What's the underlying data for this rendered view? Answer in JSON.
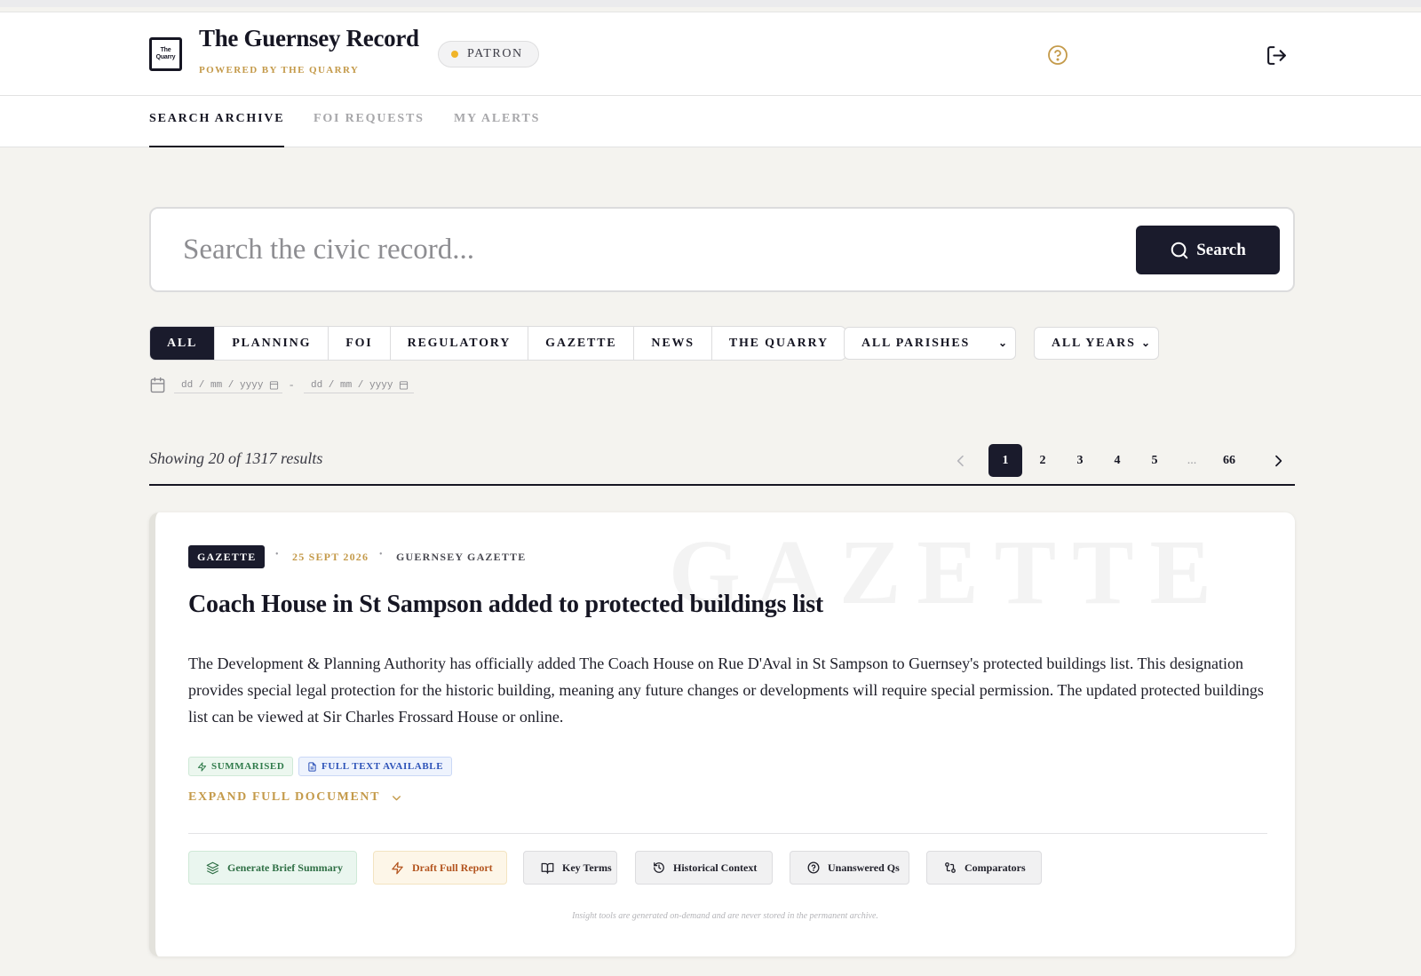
{
  "header": {
    "logo_text": "The Quarry",
    "title": "The Guernsey Record",
    "subtitle": "POWERED BY THE QUARRY",
    "badge": "PATRON",
    "badge_dot_color": "#f0b429",
    "help_icon": "help-circle-icon",
    "logout_icon": "logout-icon"
  },
  "nav": {
    "tabs": [
      {
        "label": "SEARCH ARCHIVE",
        "active": true
      },
      {
        "label": "FOI REQUESTS",
        "active": false
      },
      {
        "label": "MY ALERTS",
        "active": false
      }
    ]
  },
  "search": {
    "placeholder": "Search the civic record...",
    "value": "",
    "button_label": "Search",
    "button_icon": "search-icon"
  },
  "filters": {
    "categories": [
      {
        "label": "ALL",
        "active": true
      },
      {
        "label": "PLANNING",
        "active": false
      },
      {
        "label": "FOI",
        "active": false
      },
      {
        "label": "REGULATORY",
        "active": false
      },
      {
        "label": "GAZETTE",
        "active": false
      },
      {
        "label": "NEWS",
        "active": false
      },
      {
        "label": "THE QUARRY",
        "active": false
      }
    ],
    "parish_select": "ALL PARISHES",
    "year_select": "ALL YEARS",
    "date_from_placeholder": "dd / mm / yyyy",
    "date_to_placeholder": "dd / mm / yyyy",
    "date_separator": "-"
  },
  "results": {
    "summary": "Showing 20 of 1317 results",
    "pagination": {
      "pages": [
        "1",
        "2",
        "3",
        "4",
        "5",
        "...",
        "66"
      ],
      "current": "1"
    }
  },
  "card": {
    "watermark": "GAZETTE",
    "category": "GAZETTE",
    "date": "25 SEPT 2026",
    "source": "GUERNSEY GAZETTE",
    "title": "Coach House in St Sampson added to protected buildings list",
    "body": "The Development & Planning Authority has officially added The Coach House on Rue D'Aval in St Sampson to Guernsey's protected buildings list. This designation provides special legal protection for the historic building, meaning any future changes or developments will require special permission. The updated protected buildings list can be viewed at Sir Charles Frossard House or online.",
    "tags": [
      "SUMMARISED",
      "FULL TEXT AVAILABLE"
    ],
    "expand_label": "EXPAND FULL DOCUMENT",
    "tools": [
      {
        "label": "Generate Brief Summary",
        "icon": "layers-icon"
      },
      {
        "label": "Draft Full Report",
        "icon": "lightning-icon"
      },
      {
        "label": "Key Terms",
        "icon": "book-open-icon"
      },
      {
        "label": "Historical Context",
        "icon": "history-icon"
      },
      {
        "label": "Unanswered Qs",
        "icon": "question-circle-icon"
      },
      {
        "label": "Comparators",
        "icon": "compare-icon"
      }
    ],
    "disclaimer": "Insight tools are generated on-demand and are never stored in the permanent archive."
  },
  "colors": {
    "accent_gold": "#c49a4a",
    "navy": "#1a1b2c",
    "background": "#f4f3ef"
  }
}
